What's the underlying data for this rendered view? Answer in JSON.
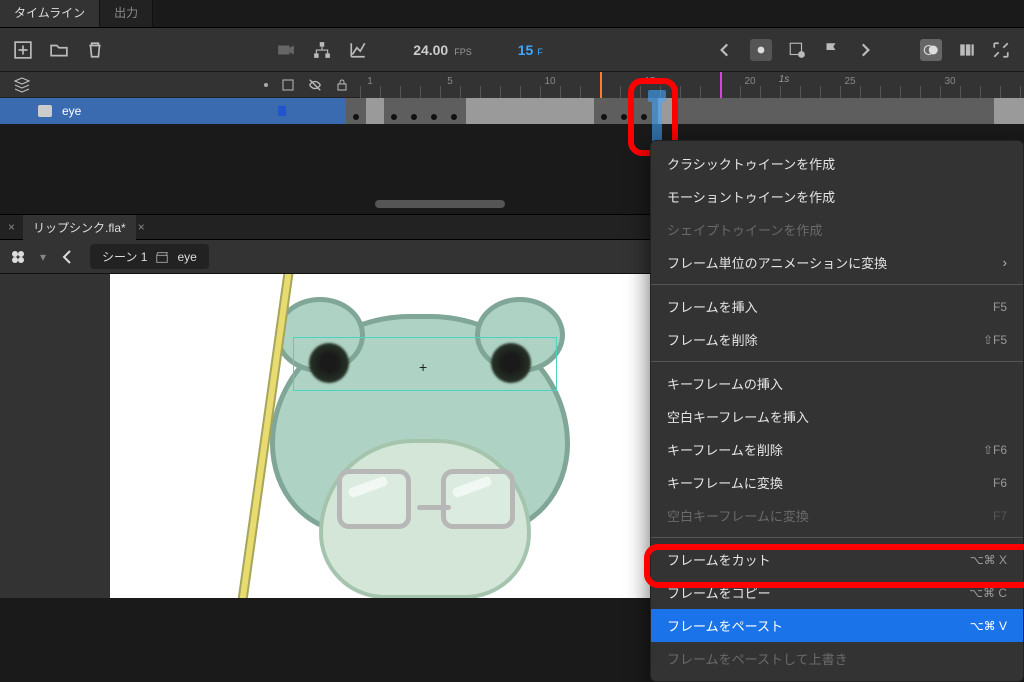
{
  "tabs": {
    "timeline": "タイムライン",
    "output": "出力"
  },
  "toolbar": {
    "fps_value": "24.00",
    "fps_label": "FPS",
    "frame_value": "15",
    "frame_label": "F"
  },
  "time_marker": "1s",
  "ruler": {
    "ticks": [
      "1",
      "5",
      "10",
      "15",
      "20",
      "25",
      "30"
    ]
  },
  "layer": {
    "name": "eye"
  },
  "document": {
    "filename": "リップシンク.fla*"
  },
  "breadcrumb": {
    "scene": "シーン 1",
    "symbol": "eye"
  },
  "context_menu": {
    "create_classic_tween": "クラシックトゥイーンを作成",
    "create_motion_tween": "モーショントゥイーンを作成",
    "create_shape_tween": "シェイプトゥイーンを作成",
    "convert_frame_anim": "フレーム単位のアニメーションに変換",
    "insert_frame": "フレームを挿入",
    "remove_frame": "フレームを削除",
    "sc_insert_frame": "F5",
    "sc_remove_frame": "⇧F5",
    "insert_keyframe": "キーフレームの挿入",
    "insert_blank_keyframe": "空白キーフレームを挿入",
    "remove_keyframe": "キーフレームを削除",
    "convert_keyframe": "キーフレームに変換",
    "convert_blank_keyframe": "空白キーフレームに変換",
    "sc_remove_keyframe": "⇧F6",
    "sc_convert_keyframe": "F6",
    "sc_convert_blank": "F7",
    "cut_frames": "フレームをカット",
    "copy_frames": "フレームをコピー",
    "paste_frames": "フレームをペースト",
    "paste_overwrite": "フレームをペーストして上書き",
    "sc_cut": "⌥⌘ X",
    "sc_copy": "⌥⌘ C",
    "sc_paste": "⌥⌘ V"
  }
}
